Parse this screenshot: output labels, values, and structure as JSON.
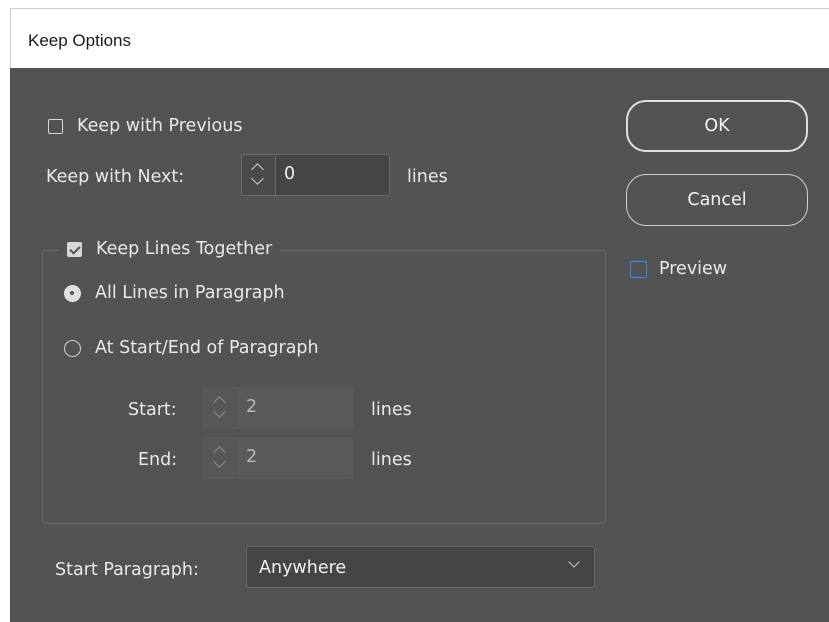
{
  "window": {
    "title": "Keep Options"
  },
  "keep_with_previous": {
    "label": "Keep with Previous",
    "checked": false
  },
  "keep_with_next": {
    "label": "Keep with Next:",
    "value": "0",
    "unit": "lines"
  },
  "keep_lines_together": {
    "label": "Keep Lines Together",
    "checked": true,
    "options": [
      {
        "label": "All Lines in Paragraph",
        "selected": true
      },
      {
        "label": "At Start/End of Paragraph",
        "selected": false
      }
    ],
    "start": {
      "label": "Start:",
      "value": "2",
      "unit": "lines"
    },
    "end": {
      "label": "End:",
      "value": "2",
      "unit": "lines"
    }
  },
  "start_paragraph": {
    "label": "Start Paragraph:",
    "selected": "Anywhere"
  },
  "buttons": {
    "ok": "OK",
    "cancel": "Cancel"
  },
  "preview": {
    "label": "Preview",
    "checked": false
  },
  "colors": {
    "dialog_bg": "#535353",
    "preview_checkbox": "#2f8ff0",
    "title_bg": "#ffffff"
  }
}
